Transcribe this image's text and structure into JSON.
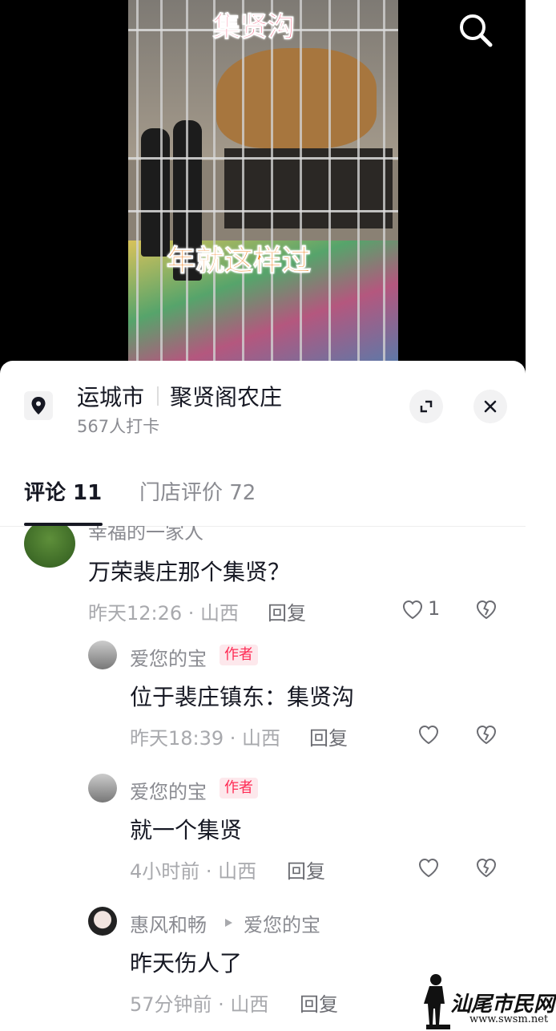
{
  "video": {
    "caption_top": "集贤沟",
    "caption_mid": "年就这样过",
    "search_icon": "search-icon"
  },
  "location": {
    "city": "运城市",
    "name": "聚贤阁农庄",
    "checkins": "567人打卡",
    "pin_icon": "location-pin-icon",
    "expand_icon": "expand-icon",
    "close_icon": "close-icon"
  },
  "tabs": {
    "comments": "评论 11",
    "store_reviews": "门店评价 72"
  },
  "comments": [
    {
      "username": "幸福的一家人",
      "text": "万荣裴庄那个集贤？",
      "meta": "昨天12:26 · 山西",
      "reply": "回复",
      "likes": "1"
    },
    {
      "username": "爱您的宝",
      "badge": "作者",
      "text": "位于裴庄镇东：集贤沟",
      "meta": "昨天18:39 · 山西",
      "reply": "回复"
    },
    {
      "username": "爱您的宝",
      "badge": "作者",
      "text": "就一个集贤",
      "meta": "4小时前 · 山西",
      "reply": "回复"
    },
    {
      "username": "惠风和畅",
      "reply_to": "爱您的宝",
      "text": "昨天伤人了",
      "meta": "57分钟前 · 山西",
      "reply": "回复"
    }
  ],
  "watermark": {
    "text": "汕尾市民网",
    "url": "www.swsm.net"
  },
  "colors": {
    "accent": "#fe2c55",
    "text": "#161823",
    "muted": "#8a8b91"
  }
}
